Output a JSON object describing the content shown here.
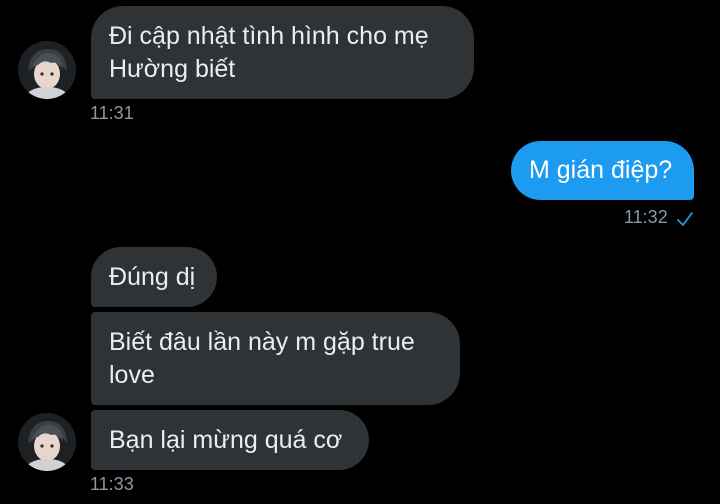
{
  "messages": {
    "m1": {
      "text": "Đi cập nhật tình hình cho mẹ\nHường biết",
      "time": "11:31"
    },
    "m2": {
      "text": "M gián điệp?",
      "time": "11:32"
    },
    "m3": {
      "text": "Đúng dị"
    },
    "m4": {
      "text": "Biết đâu lần này m gặp true\nlove"
    },
    "m5": {
      "text": "Bạn lại mừng quá cơ",
      "time": "11:33"
    }
  },
  "colors": {
    "background": "#000000",
    "incoming_bubble": "#2f3336",
    "outgoing_bubble": "#1d9bf0",
    "timestamp": "#8b98a5"
  },
  "icons": {
    "read_receipt": "check-icon",
    "contact_avatar": "avatar"
  }
}
